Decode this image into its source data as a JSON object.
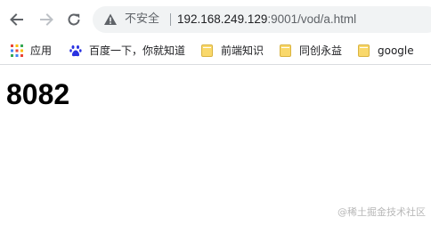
{
  "browser": {
    "insecure_label": "不安全",
    "url_host": "192.168.249.129",
    "url_rest": ":9001/vod/a.html"
  },
  "bookmarks": [
    {
      "label": "应用",
      "icon": "apps-grid-icon"
    },
    {
      "label": "百度一下，你就知道",
      "icon": "baidu-paw-icon"
    },
    {
      "label": "前端知识",
      "icon": "folder-icon"
    },
    {
      "label": "同创永益",
      "icon": "folder-icon"
    },
    {
      "label": "google",
      "icon": "folder-icon"
    }
  ],
  "page": {
    "heading": "8082"
  },
  "watermark": "@稀土掘金技术社区",
  "colors": {
    "omnibox_bg": "#f1f3f4",
    "folder": "#f9d86b",
    "baidu_blue": "#2932e1"
  }
}
